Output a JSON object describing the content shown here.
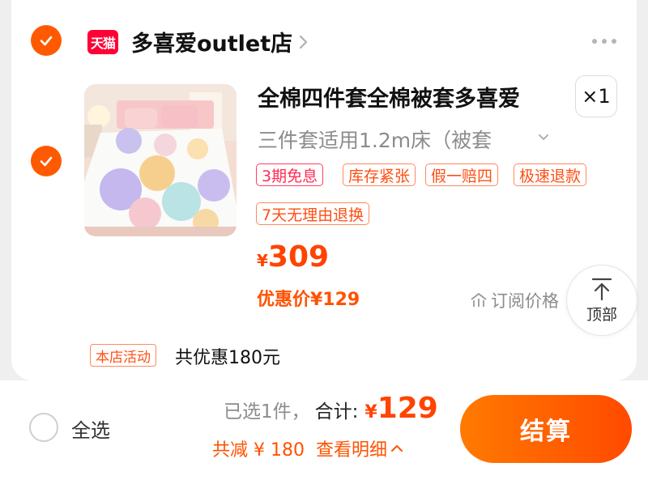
{
  "store": {
    "logo_text": "天猫",
    "name": "多喜爱outlet店"
  },
  "item": {
    "title": "全棉四件套全棉被套多喜爱",
    "quantity": "×1",
    "sku": "三件套适用1.2m床（被套",
    "tags": [
      "3期免息",
      "库存紧张",
      "假一赔四",
      "极速退款",
      "7天无理由退换"
    ],
    "price_currency": "¥",
    "price": "309",
    "promo_price": "优惠价¥129",
    "subscribe_label": "订阅价格"
  },
  "back_to_top": {
    "label": "顶部"
  },
  "activity": {
    "tag": "本店活动",
    "text": "共优惠180元"
  },
  "footer": {
    "select_all": "全选",
    "selected_count": "已选1件，",
    "total_label": "合计:",
    "total_currency": "¥",
    "total_amount": "129",
    "discount": "共减 ¥ 180",
    "view_detail": "查看明细",
    "checkout": "结算"
  },
  "colors": {
    "accent": "#ff5a00",
    "price": "#ff4400",
    "tmall_red": "#ff0036"
  }
}
